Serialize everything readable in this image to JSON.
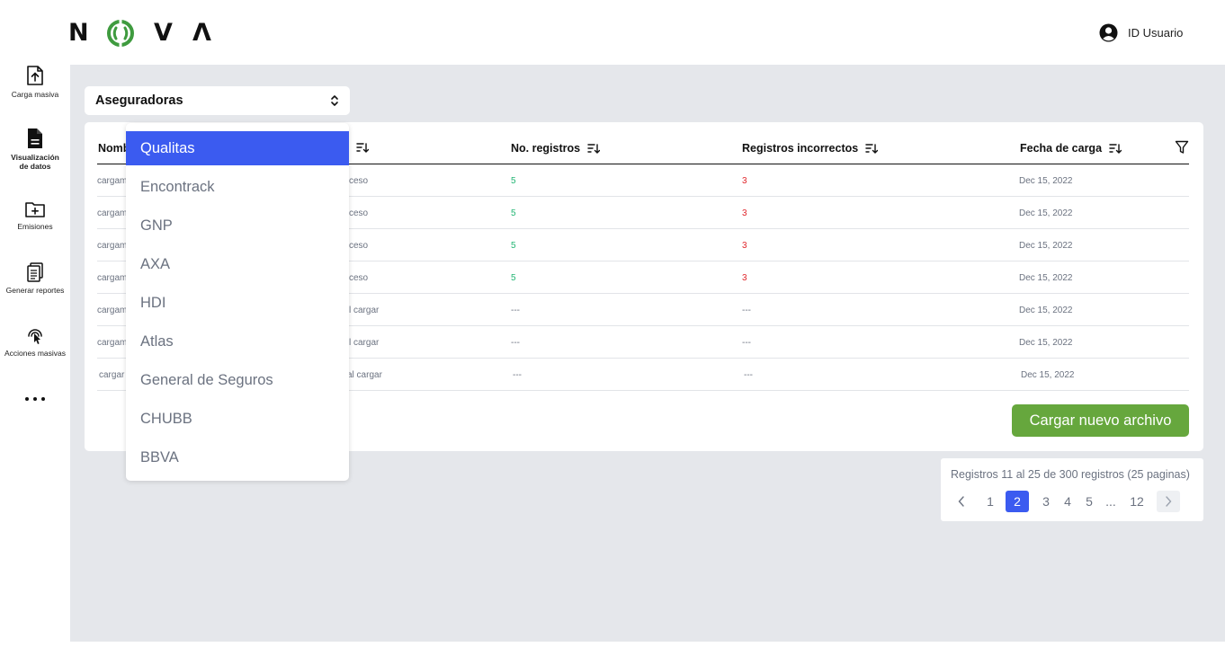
{
  "colors": {
    "accent": "#3b5bf0",
    "success_green": "#22b573",
    "error_red": "#e0262b",
    "button_green": "#66a73d",
    "logo_green": "#3f9b3f",
    "content_bg": "#e5e7eb"
  },
  "brand": {
    "letters": [
      "N",
      "V",
      "Λ"
    ]
  },
  "header": {
    "user_label": "ID Usuario",
    "user_icon": "user-circle-icon"
  },
  "sidebar": {
    "items": [
      {
        "label": "Carga masiva",
        "icon": "upload-file-icon"
      },
      {
        "label": "Visualización de datos",
        "icon": "document-icon"
      },
      {
        "label": "Emisiones",
        "icon": "folder-plus-icon"
      },
      {
        "label": "Generar reportes",
        "icon": "report-icon"
      },
      {
        "label": "Acciones masivas",
        "icon": "touch-icon"
      }
    ],
    "more_icon": "more-dots-icon"
  },
  "select": {
    "value": "Aseguradoras"
  },
  "dropdown": {
    "options": [
      "Qualitas",
      "Encontrack",
      "GNP",
      "AXA",
      "HDI",
      "Atlas",
      "General de Seguros",
      "CHUBB",
      "BBVA"
    ],
    "selected": "Qualitas"
  },
  "table": {
    "headers": {
      "name": "Nombre",
      "status": "",
      "records": "No. registros",
      "incorrect": "Registros incorrectos",
      "date": "Fecha de carga"
    },
    "rows": [
      {
        "name": "cargam",
        "status": "ceso",
        "records": "5",
        "incorrect": "3",
        "date": "Dec 15, 2022"
      },
      {
        "name": "cargam",
        "status": "ceso",
        "records": "5",
        "incorrect": "3",
        "date": "Dec 15, 2022"
      },
      {
        "name": "cargam",
        "status": "ceso",
        "records": "5",
        "incorrect": "3",
        "date": "Dec 15, 2022"
      },
      {
        "name": "cargam",
        "status": "ceso",
        "records": "5",
        "incorrect": "3",
        "date": "Dec 15, 2022"
      },
      {
        "name": "cargam",
        "status": "l cargar",
        "records": "---",
        "incorrect": "---",
        "date": "Dec 15, 2022"
      },
      {
        "name": "cargam",
        "status": "l cargar",
        "records": "---",
        "incorrect": "---",
        "date": "Dec 15, 2022"
      },
      {
        "name": "cargar",
        "status": "al cargar",
        "records": "---",
        "incorrect": "---",
        "date": "Dec 15, 2022"
      }
    ]
  },
  "upload_button": "Cargar nuevo archivo",
  "pagination": {
    "info": "Registros 11 al 25 de 300 registros (25 paginas)",
    "pages": [
      "1",
      "2",
      "3",
      "4",
      "5",
      "...",
      "12"
    ],
    "current": "2"
  }
}
